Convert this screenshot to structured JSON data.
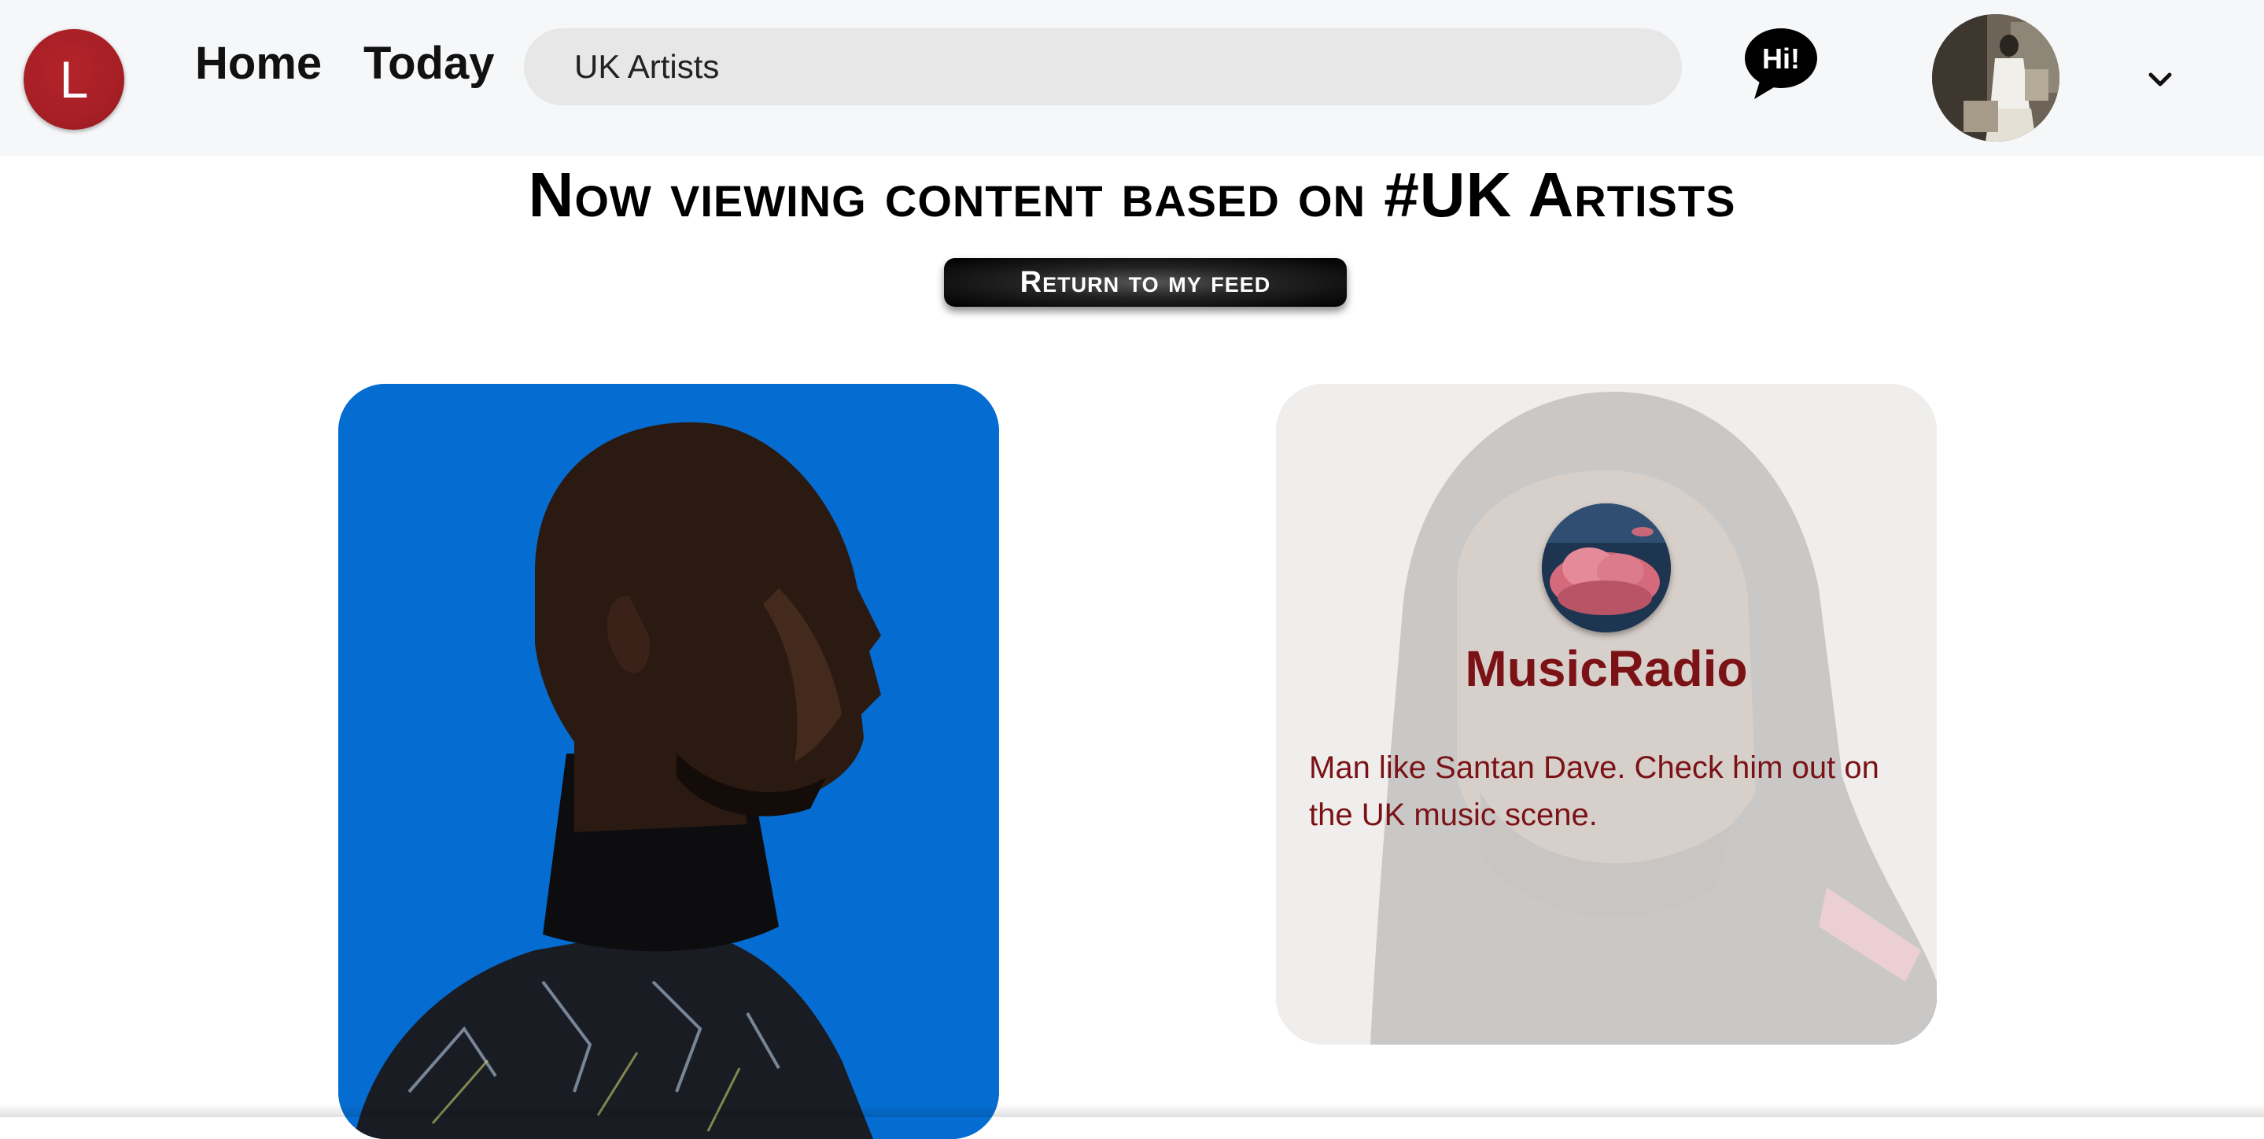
{
  "header": {
    "logo_letter": "L",
    "nav": {
      "home_label": "Home",
      "today_label": "Today"
    },
    "search": {
      "value": "UK Artists",
      "icon": "none"
    },
    "hi_button_label": "Hi!",
    "hi_icon": "speech-bubble-icon",
    "profile_avatar": "user-avatar-photo",
    "menu_icon": "chevron-down-icon"
  },
  "main": {
    "heading": "Now viewing content based on #UK Artists",
    "return_button_label": "Return to my feed"
  },
  "cards": [
    {
      "type": "image-pin",
      "background_color": "#056dd1",
      "image": "profile-portrait-photo"
    },
    {
      "type": "text-pin",
      "channel_name": "MusicRadio",
      "channel_avatar": "pink-cloud-photo",
      "text": "Man like Santan Dave. Check him out on the UK music scene.",
      "text_color": "#7a1216"
    }
  ],
  "colors": {
    "brand_red": "#a71f25",
    "header_bg": "#f6f7f9",
    "search_bg": "#e7e7e7"
  }
}
